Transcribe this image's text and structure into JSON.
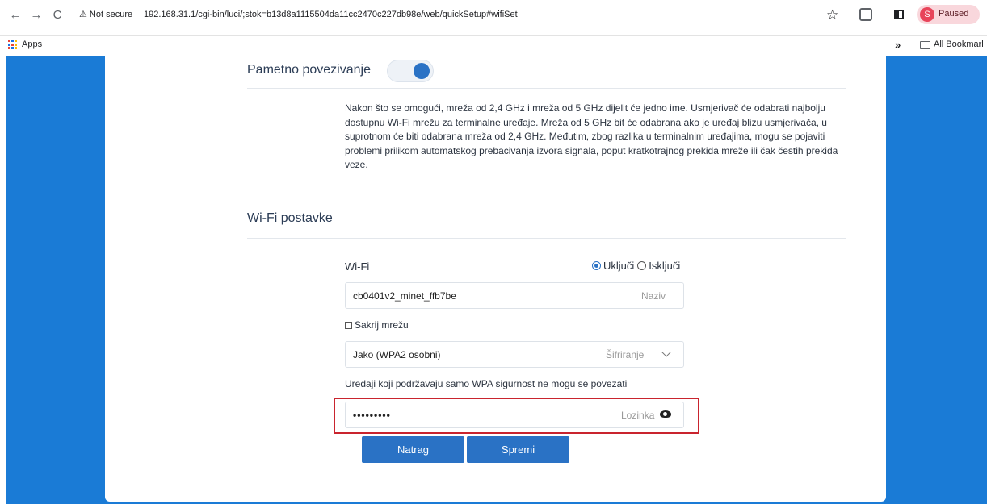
{
  "browser": {
    "security_badge": "⚠ Not secure",
    "url": "192.168.31.1/cgi-bin/luci/;stok=b13d8a1115504da11cc2470c227db98e/web/quickSetup#wifiSet",
    "profile_initial": "S",
    "profile_status": "Paused",
    "nav": {
      "back": "←",
      "forward": "→",
      "reload": "C"
    },
    "star": "☆"
  },
  "bookmarks": {
    "apps_label": "Apps",
    "more": "»",
    "all_bookmarks": "All Bookmarl"
  },
  "smart_connect": {
    "title": "Pametno povezivanje",
    "enabled": true,
    "description": "Nakon što se omogući, mreža od 2,4 GHz i mreža od 5 GHz dijelit će jedno ime. Usmjerivač će odabrati najbolju dostupnu Wi-Fi mrežu za terminalne uređaje. Mreža od 5 GHz bit će odabrana ako je uređaj blizu usmjerivača, u suprotnom će biti odabrana mreža od 2,4 GHz. Međutim, zbog razlika u terminalnim uređajima, mogu se pojaviti problemi prilikom automatskog prebacivanja izvora signala, poput kratkotrajnog prekida mreže ili čak čestih prekida veze."
  },
  "wifi": {
    "section_title": "Wi-Fi postavke",
    "label": "Wi-Fi",
    "on_label": "Uključi",
    "off_label": "Isključi",
    "selected": "on",
    "ssid_value": "cb0401v2_minet_ffb7be",
    "ssid_placeholder": "Naziv",
    "hide_network_label": "Sakrij mrežu",
    "encryption_value": "Jako (WPA2 osobni)",
    "encryption_placeholder": "Šifriranje",
    "wpa_notice": "Uređaji koji podržavaju samo WPA sigurnost ne mogu se povezati",
    "password_value": "•••••••••",
    "password_placeholder": "Lozinka"
  },
  "buttons": {
    "back": "Natrag",
    "save": "Spremi"
  },
  "colors": {
    "page_background": "#1a7bd6",
    "accent": "#2a72c5",
    "highlight": "#c9242e"
  }
}
